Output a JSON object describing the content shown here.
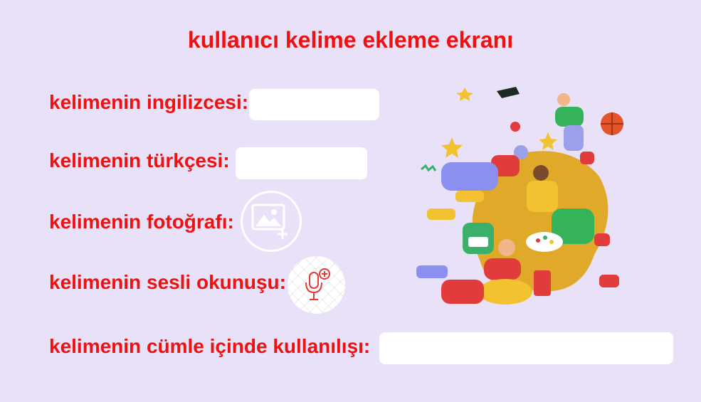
{
  "title": "kullanıcı kelime ekleme ekranı",
  "fields": {
    "english": {
      "label": "kelimenin ingilizcesi:",
      "value": ""
    },
    "turkish": {
      "label": "kelimenin türkçesi:",
      "value": ""
    },
    "photo": {
      "label": "kelimenin fotoğrafı:",
      "icon": "add-image-icon"
    },
    "audio": {
      "label": "kelimenin sesli okunuşu:",
      "icon": "add-microphone-icon"
    },
    "sentence": {
      "label": "kelimenin cümle içinde kullanılışı:",
      "value": ""
    }
  },
  "colors": {
    "background": "#e9e1f7",
    "accent": "#ee1111",
    "field": "#ffffff"
  }
}
